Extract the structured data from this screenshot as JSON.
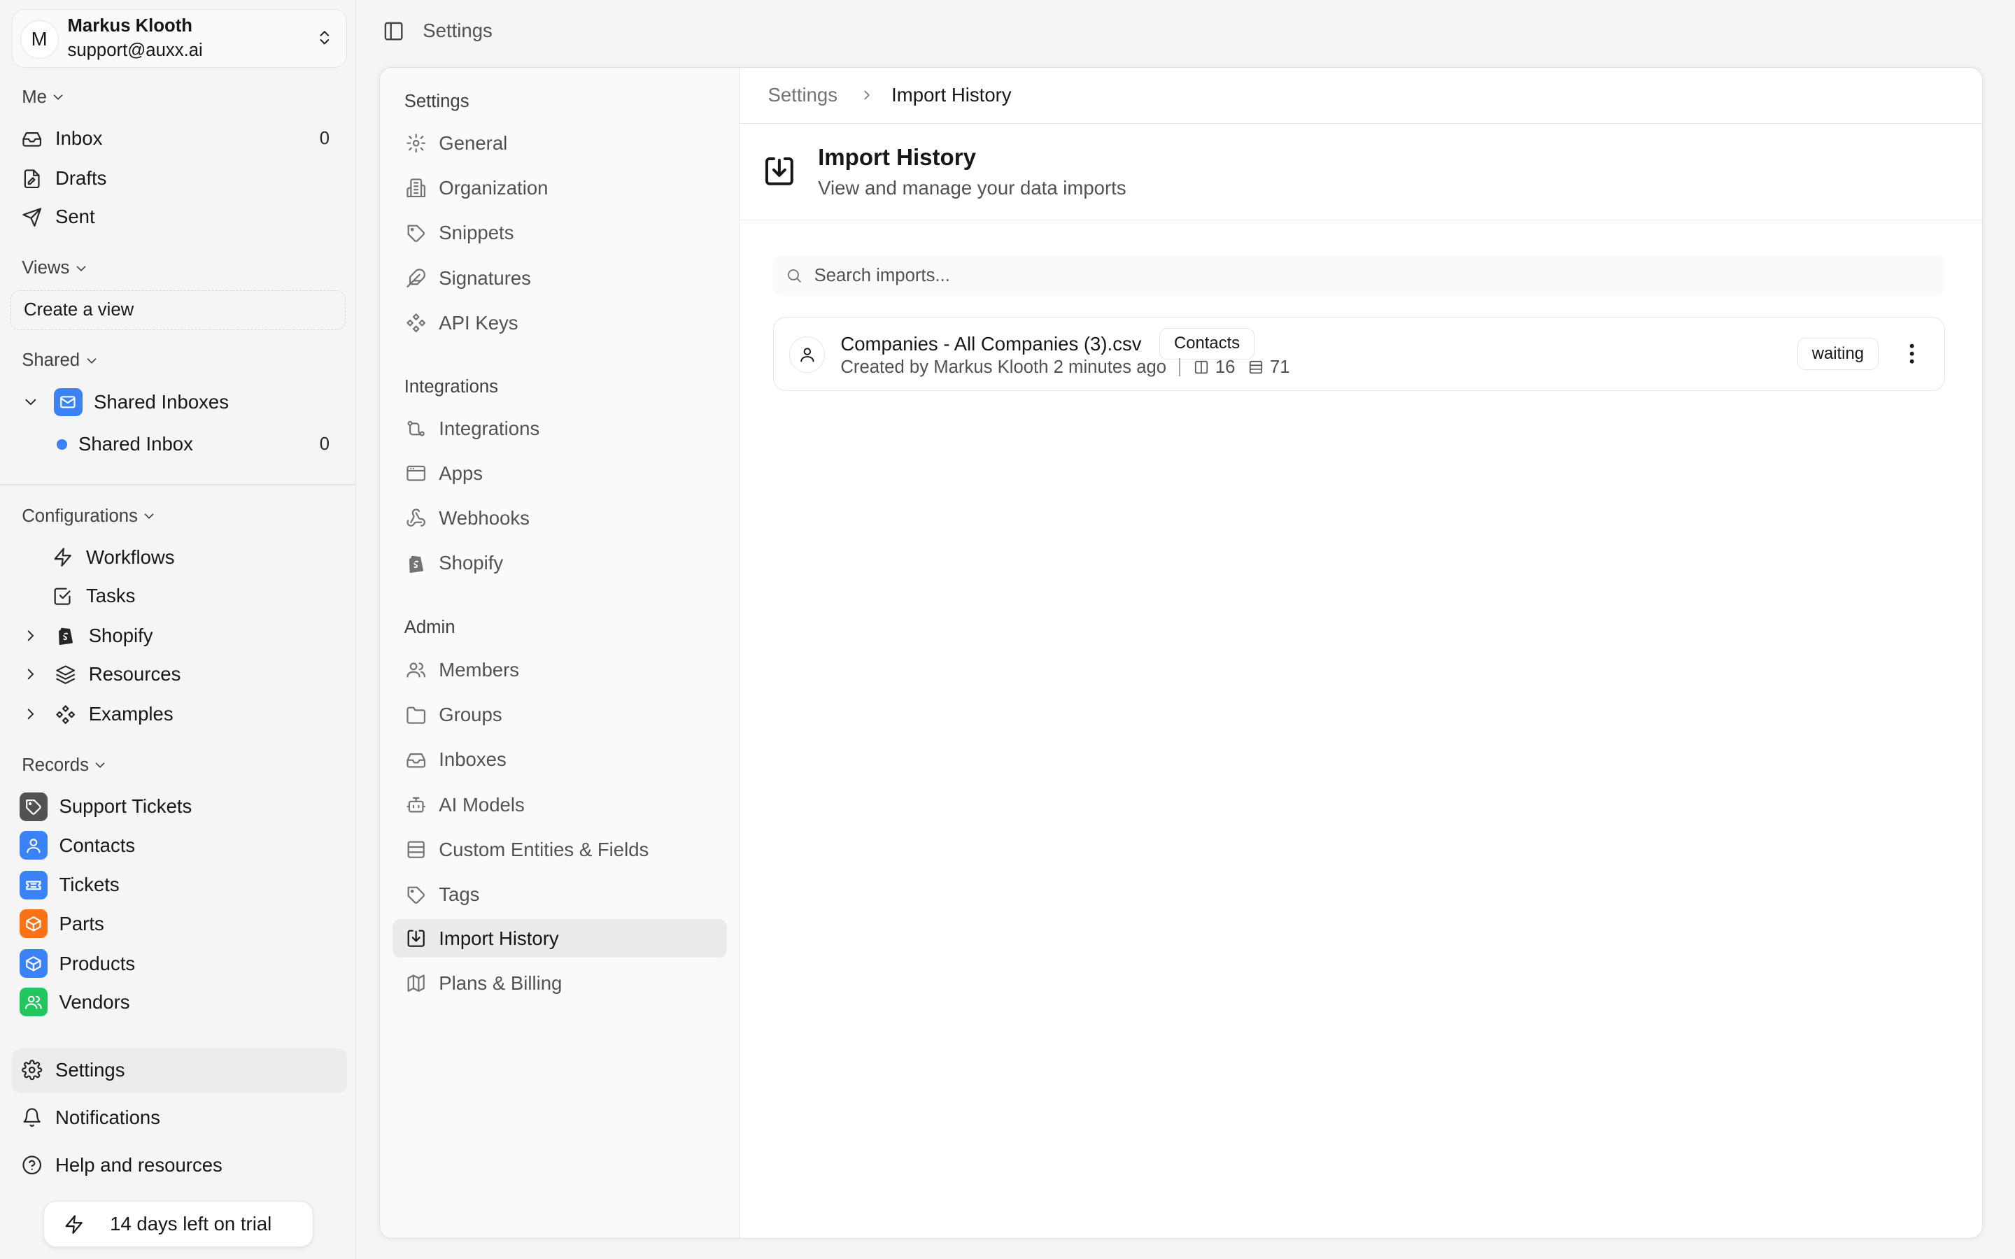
{
  "user": {
    "initial": "M",
    "name": "Markus Klooth",
    "email": "support@auxx.ai"
  },
  "sidebar": {
    "me_label": "Me",
    "me_items": [
      {
        "label": "Inbox",
        "count": "0",
        "icon": "inbox-icon"
      },
      {
        "label": "Drafts",
        "icon": "drafts-icon"
      },
      {
        "label": "Sent",
        "icon": "send-icon"
      }
    ],
    "views_label": "Views",
    "create_view": "Create a view",
    "shared_label": "Shared",
    "shared_inboxes": "Shared Inboxes",
    "shared_inbox": {
      "label": "Shared Inbox",
      "count": "0"
    },
    "configurations_label": "Configurations",
    "config_items": [
      {
        "label": "Workflows",
        "icon": "bolt-icon"
      },
      {
        "label": "Tasks",
        "icon": "check-square-icon"
      },
      {
        "label": "Shopify",
        "icon": "shopify-icon"
      },
      {
        "label": "Resources",
        "icon": "layers-icon"
      },
      {
        "label": "Examples",
        "icon": "components-icon"
      }
    ],
    "records_label": "Records",
    "records": [
      {
        "label": "Support Tickets",
        "color": "#525252"
      },
      {
        "label": "Contacts",
        "color": "#3b82f6"
      },
      {
        "label": "Tickets",
        "color": "#3b82f6"
      },
      {
        "label": "Parts",
        "color": "#f97316"
      },
      {
        "label": "Products",
        "color": "#3b82f6"
      },
      {
        "label": "Vendors",
        "color": "#22c55e"
      }
    ],
    "settings": "Settings",
    "notifications": "Notifications",
    "help": "Help and resources",
    "trial": "14 days left on trial"
  },
  "topbar": {
    "title": "Settings"
  },
  "settings_nav": {
    "settings_heading": "Settings",
    "settings_items": [
      "General",
      "Organization",
      "Snippets",
      "Signatures",
      "API Keys"
    ],
    "integrations_heading": "Integrations",
    "integrations_items": [
      "Integrations",
      "Apps",
      "Webhooks",
      "Shopify"
    ],
    "admin_heading": "Admin",
    "admin_items": [
      "Members",
      "Groups",
      "Inboxes",
      "AI Models",
      "Custom Entities & Fields",
      "Tags",
      "Import History",
      "Plans & Billing"
    ]
  },
  "breadcrumb": {
    "parent": "Settings",
    "current": "Import History"
  },
  "header": {
    "title": "Import History",
    "subtitle": "View and manage your data imports"
  },
  "search": {
    "placeholder": "Search imports..."
  },
  "imports": [
    {
      "file_name": "Companies - All Companies (3).csv",
      "entity": "Contacts",
      "created": "Created by Markus Klooth 2 minutes ago",
      "columns": "16",
      "rows": "71",
      "status": "waiting"
    }
  ]
}
